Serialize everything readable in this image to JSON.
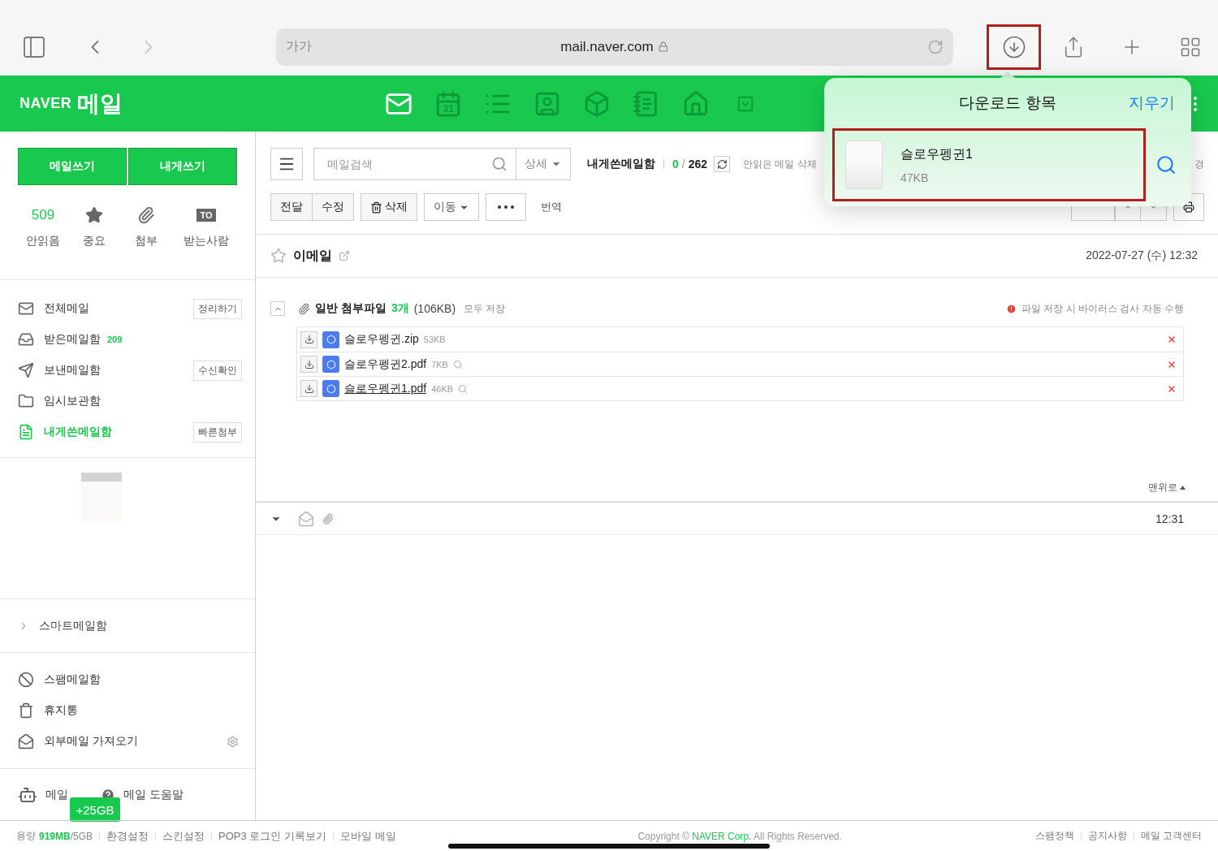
{
  "browser": {
    "text_size": "가가",
    "url": "mail.naver.com",
    "download_button": {
      "highlighted": true
    }
  },
  "header": {
    "brand": "NAVER",
    "product": "메일",
    "calendar_day": "31"
  },
  "sidebar": {
    "compose_buttons": [
      "메일쓰기",
      "내게쓰기"
    ],
    "stats": [
      {
        "value": "509",
        "label": "안읽음"
      },
      {
        "label": "중요"
      },
      {
        "label": "첨부"
      },
      {
        "badge": "TO",
        "label": "받는사람"
      }
    ],
    "folders": [
      {
        "label": "전체메일",
        "action": "정리하기",
        "selected": false
      },
      {
        "label": "받은메일함",
        "count": "209",
        "selected": false
      },
      {
        "label": "보낸메일함",
        "action": "수신확인",
        "selected": false
      },
      {
        "label": "임시보관함",
        "selected": false
      },
      {
        "label": "내게쓴메일함",
        "action": "빠른첨부",
        "selected": true
      }
    ],
    "smart_mailbox": {
      "label": "스마트메일함",
      "expanded": false
    },
    "other_folders": [
      {
        "label": "스팸메일함",
        "settings": false
      },
      {
        "label": "휴지통",
        "settings": false
      },
      {
        "label": "외부메일 가져오기",
        "settings": true
      }
    ],
    "bottom_links": [
      "메일",
      "메일 도움말"
    ],
    "storage_badge": "+25GB"
  },
  "toolbar": {
    "search": {
      "placeholder": "메일검색"
    },
    "detail": "상세",
    "folder": "내게쓴메일함",
    "unread": "0",
    "separator": "/",
    "total": "262",
    "delete_unread": "안읽은 메일 삭제",
    "partial": "경",
    "actions": [
      "전달",
      "수정",
      "삭제",
      "이동"
    ],
    "translate": "번역"
  },
  "message": {
    "subject": "이메일",
    "starred": false,
    "date": "2022-07-27 (수) 12:32",
    "attachments": {
      "expanded": true,
      "title": "일반 첨부파일",
      "count": "3개",
      "size": "(106KB)",
      "save_all": "모두 저장",
      "notice": "파일 저장 시 바이러스 검사 자동 수행",
      "files": [
        {
          "name": "슬로우펭귄.zip",
          "size": "53KB",
          "previewable": false,
          "underlined": false
        },
        {
          "name": "슬로우펭귄2.pdf",
          "size": "7KB",
          "previewable": true,
          "underlined": false
        },
        {
          "name": "슬로우펭귄1.pdf",
          "size": "46KB",
          "previewable": true,
          "underlined": true
        }
      ]
    },
    "to_top": "맨위로"
  },
  "list_row": {
    "time": "12:31"
  },
  "footer": {
    "storage_label": "용량",
    "storage_used": "919MB",
    "storage_total": "/5GB",
    "links": [
      "환경설정",
      "스킨설정",
      "POP3 로그인 기록보기",
      "모바일 메일"
    ],
    "copyright": {
      "before": "Copyright ©",
      "company": "NAVER Corp.",
      "after": "All Rights Reserved."
    },
    "right_links": [
      "스팸정책",
      "공지사항",
      "메일 고객센터"
    ]
  },
  "downloads": {
    "title": "다운로드 항목",
    "clear": "지우기",
    "items": [
      {
        "name": "슬로우펭귄1",
        "size": "47KB",
        "highlighted": true
      }
    ]
  }
}
